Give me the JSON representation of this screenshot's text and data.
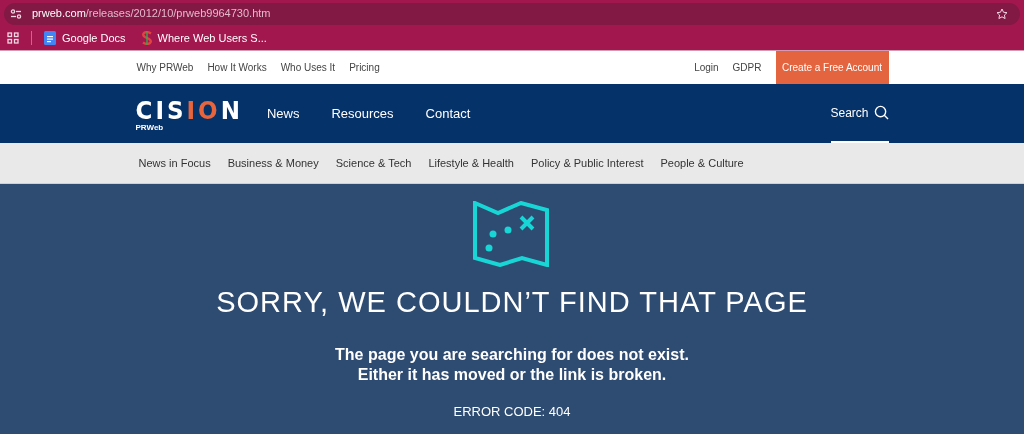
{
  "browser": {
    "url_host": "prweb.com",
    "url_path": "/releases/2012/10/prweb9964730.htm",
    "bookmarks": [
      {
        "kind": "docs",
        "label": "Google Docs"
      },
      {
        "kind": "site",
        "label": "Where Web Users S..."
      }
    ]
  },
  "top_nav": {
    "left": [
      "Why PRWeb",
      "How It Works",
      "Who Uses It",
      "Pricing"
    ],
    "right": [
      "Login",
      "GDPR"
    ],
    "cta": "Create a Free Account"
  },
  "header": {
    "logo": {
      "parts": [
        {
          "text": "CIS",
          "color": "#ffffff"
        },
        {
          "text": "IO",
          "color": "#e8643c"
        },
        {
          "text": "N",
          "color": "#ffffff"
        }
      ],
      "sub": "PRWeb"
    },
    "nav": [
      "News",
      "Resources",
      "Contact"
    ],
    "search": "Search"
  },
  "categories": [
    "News in Focus",
    "Business & Money",
    "Science & Tech",
    "Lifestyle & Health",
    "Policy & Public Interest",
    "People & Culture"
  ],
  "error": {
    "title": "SORRY, WE COULDN’T FIND THAT PAGE",
    "lines": [
      "The page you are searching for does not exist.",
      "Either it has moved or the link is broken."
    ],
    "code": "ERROR CODE: 404"
  }
}
